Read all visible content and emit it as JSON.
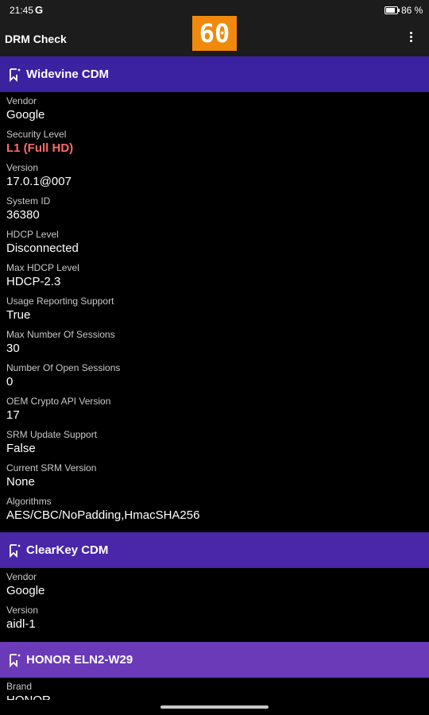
{
  "status_bar": {
    "time": "21:45",
    "carrier_icon": "G",
    "battery_percent": "86 %",
    "battery_level": 0.86
  },
  "app_bar": {
    "title": "DRM Check",
    "fps_badge": "60",
    "menu_icon": "more-vert-icon"
  },
  "sections": [
    {
      "header": "Widevine CDM",
      "color": "#3a22a0",
      "icon": "bookmark-icon",
      "fields": [
        {
          "label": "Vendor",
          "value": "Google"
        },
        {
          "label": "Security Level",
          "value": "L1 (Full HD)",
          "highlight": "#ff6b6b"
        },
        {
          "label": "Version",
          "value": "17.0.1@007"
        },
        {
          "label": "System ID",
          "value": "36380"
        },
        {
          "label": "HDCP Level",
          "value": "Disconnected"
        },
        {
          "label": "Max HDCP Level",
          "value": "HDCP-2.3"
        },
        {
          "label": "Usage Reporting Support",
          "value": "True"
        },
        {
          "label": "Max Number Of Sessions",
          "value": "30"
        },
        {
          "label": "Number Of Open Sessions",
          "value": "0"
        },
        {
          "label": "OEM Crypto API Version",
          "value": "17"
        },
        {
          "label": "SRM Update Support",
          "value": "False"
        },
        {
          "label": "Current SRM Version",
          "value": "None"
        },
        {
          "label": "Algorithms",
          "value": "AES/CBC/NoPadding,HmacSHA256"
        }
      ]
    },
    {
      "header": "ClearKey CDM",
      "color": "#4a26a8",
      "icon": "bookmark-icon",
      "fields": [
        {
          "label": "Vendor",
          "value": "Google"
        },
        {
          "label": "Version",
          "value": "aidl-1"
        }
      ]
    },
    {
      "header": "HONOR ELN2-W29",
      "color": "#6a3ab8",
      "icon": "bookmark-icon",
      "fields": [
        {
          "label": "Brand",
          "value": "HONOR"
        }
      ]
    }
  ]
}
